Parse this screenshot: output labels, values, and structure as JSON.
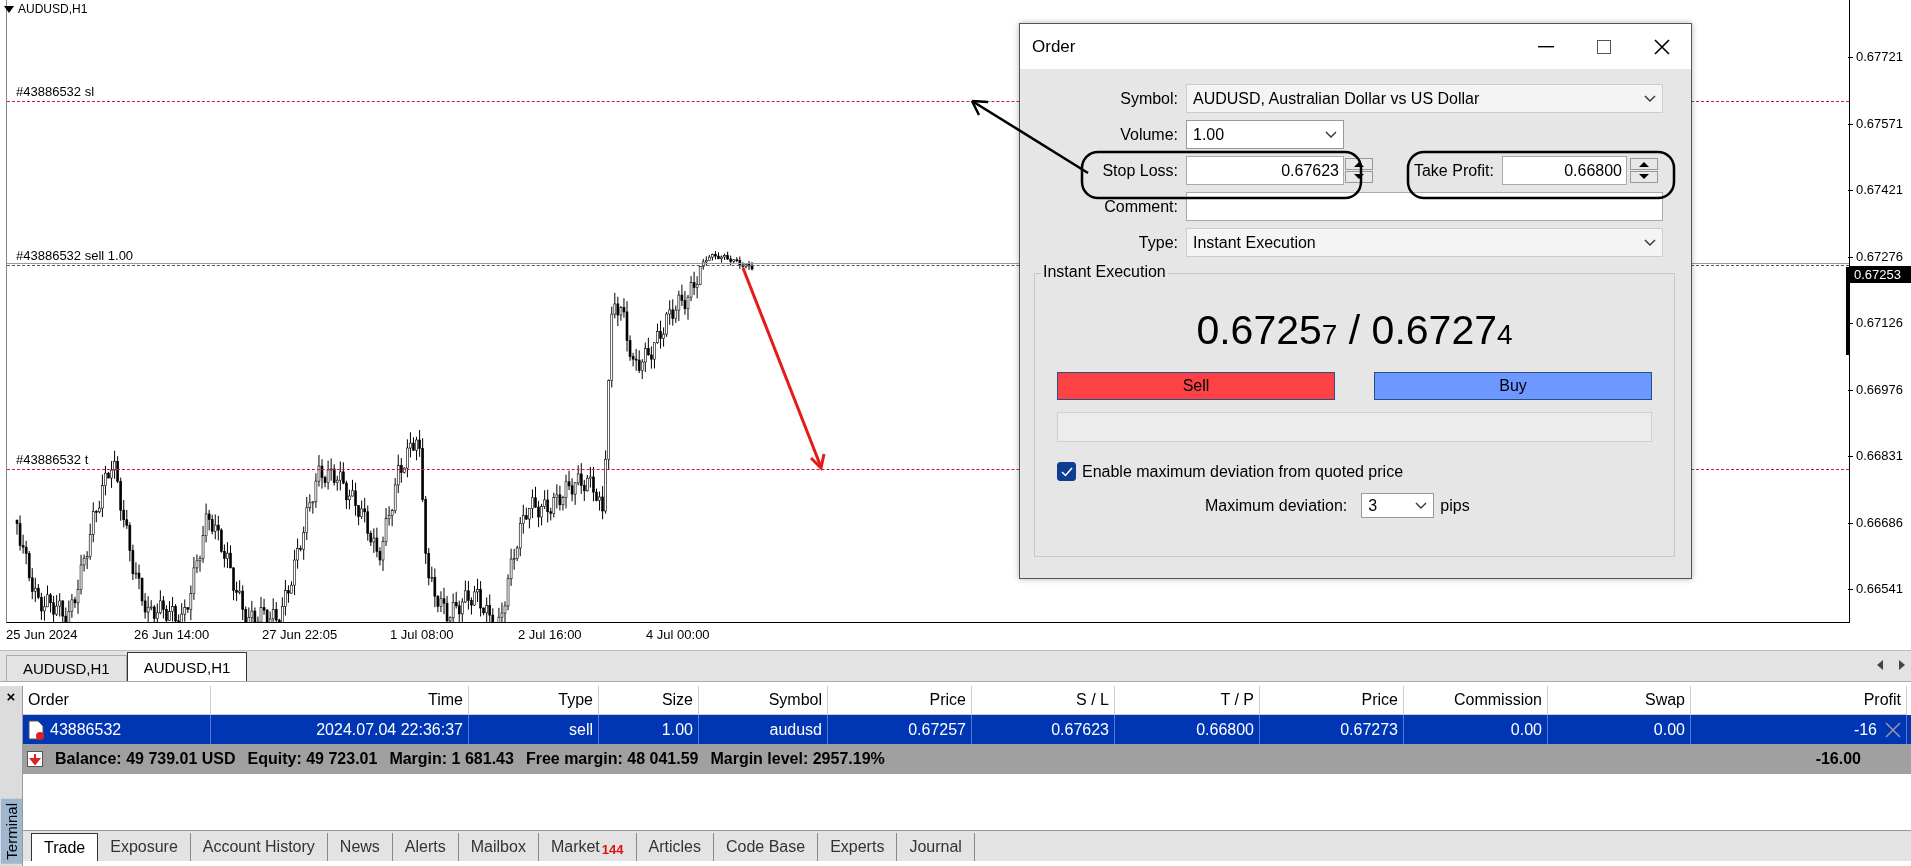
{
  "chart": {
    "title": "AUDUSD,H1",
    "levels": [
      {
        "kind": "sl",
        "label": "#43886532 sl"
      },
      {
        "kind": "entry",
        "label": "#43886532 sell 1.00"
      },
      {
        "kind": "tp",
        "label": "#43886532 t"
      }
    ],
    "price_axis": [
      "0.67721",
      "0.67571",
      "0.67421",
      "0.67276",
      "0.67126",
      "0.66976",
      "0.66831",
      "0.66686",
      "0.66541"
    ],
    "current_price": "0.67253",
    "time_axis": [
      "25 Jun 2024",
      "26 Jun 14:00",
      "27 Jun 22:05",
      "1 Jul 08:00",
      "2 Jul 16:00",
      "4 Jul 00:00"
    ]
  },
  "chart_tabs": [
    {
      "label": "AUDUSD,H1",
      "selected": false
    },
    {
      "label": "AUDUSD,H1",
      "selected": true
    }
  ],
  "order_dialog": {
    "title": "Order",
    "symbol": {
      "label": "Symbol:",
      "value": "AUDUSD, Australian Dollar vs US Dollar"
    },
    "volume": {
      "label": "Volume:",
      "value": "1.00"
    },
    "stop_loss": {
      "label": "Stop Loss:",
      "value": "0.67623"
    },
    "take_profit": {
      "label": "Take Profit:",
      "value": "0.66800"
    },
    "comment": {
      "label": "Comment:"
    },
    "type": {
      "label": "Type:",
      "value": "Instant Execution"
    },
    "execution": {
      "title": "Instant Execution",
      "bid": {
        "price": "0.6725",
        "pip": "7"
      },
      "separator": "/",
      "ask": {
        "price": "0.6727",
        "pip": "4"
      },
      "buttons": [
        {
          "label": "Sell",
          "kind": "sell"
        },
        {
          "label": "Buy",
          "kind": "buy"
        }
      ],
      "deviation_option": {
        "label": "Enable maximum deviation from quoted price",
        "checked": true
      },
      "max_deviation": {
        "label": "Maximum deviation:",
        "value": "3",
        "unit": "pips"
      }
    }
  },
  "terminal": {
    "title": "Terminal",
    "close": "×",
    "columns": [
      "Order",
      "Time",
      "Type",
      "Size",
      "Symbol",
      "Price",
      "S / L",
      "T / P",
      "Price",
      "Commission",
      "Swap",
      "Profit"
    ],
    "rows": [
      {
        "selected": true,
        "cells": [
          "43886532",
          "2024.07.04 22:36:37",
          "sell",
          "1.00",
          "audusd",
          "0.67257",
          "0.67623",
          "0.66800",
          "0.67273",
          "0.00",
          "0.00",
          "-16"
        ]
      }
    ],
    "summary": [
      "Balance: 49 739.01 USD",
      "Equity: 49 723.01",
      "Margin: 1 681.43",
      "Free margin: 48 041.59",
      "Margin level: 2957.19%"
    ],
    "summary_profit": "-16.00",
    "tabs": [
      {
        "label": "Trade",
        "selected": true
      },
      {
        "label": "Exposure",
        "selected": false
      },
      {
        "label": "Account History",
        "selected": false
      },
      {
        "label": "News",
        "selected": false
      },
      {
        "label": "Alerts",
        "selected": false
      },
      {
        "label": "Mailbox",
        "selected": false
      },
      {
        "label": "Market",
        "badge": "144",
        "selected": false
      },
      {
        "label": "Articles",
        "selected": false
      },
      {
        "label": "Code Base",
        "selected": false
      },
      {
        "label": "Experts",
        "selected": false
      },
      {
        "label": "Journal",
        "selected": false
      }
    ]
  }
}
